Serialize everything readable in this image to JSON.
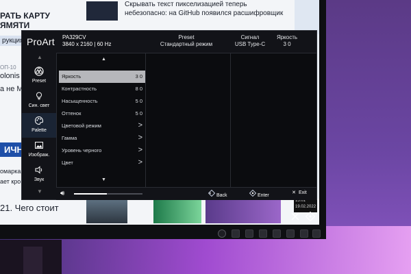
{
  "desktop": {
    "left_title": "РАТЬ КАРТУ\nЯМЯТИ",
    "left_sub": "рукция",
    "left_topic": "ОП-10",
    "left_topic2": "olonis",
    "left_topic3": "а не М",
    "left_tag": "ИЧНО",
    "left_small1": "омарка",
    "left_small2": "ает кро",
    "left_headline": "21. Чего стоит",
    "top_text": "Скрывать текст пикселизацией теперь небезопасно: на GitHub появился расшифровщик",
    "tray_date": "19.02.2022",
    "tray_time": "15:01"
  },
  "osd": {
    "brand": "ProArt",
    "model": "PA329CV",
    "resolution": "3840 x 2160",
    "refresh": "60 Hz",
    "header": {
      "preset_label": "Preset",
      "preset_value": "Стандартный режим",
      "signal_label": "Сигнал",
      "signal_value": "USB Type-C",
      "brightness_label": "Яркость",
      "brightness_value": "3 0"
    },
    "sidebar": [
      {
        "label": "Preset",
        "icon": "palette-wheel-icon"
      },
      {
        "label": "Син. свет",
        "icon": "bulb-icon"
      },
      {
        "label": "Palette",
        "icon": "palette-icon",
        "active": true
      },
      {
        "label": "Изображ.",
        "icon": "image-icon"
      },
      {
        "label": "Звук",
        "icon": "speaker-icon"
      }
    ],
    "menu": [
      {
        "label": "Яркость",
        "value": "3 0",
        "selected": true
      },
      {
        "label": "Контрастность",
        "value": "8 0"
      },
      {
        "label": "Насыщенность",
        "value": "5 0"
      },
      {
        "label": "Оттенок",
        "value": "5 0"
      },
      {
        "label": "Цветовой режим",
        "value": ">"
      },
      {
        "label": "Гамма",
        "value": ">"
      },
      {
        "label": "Уровень черного",
        "value": ">"
      },
      {
        "label": "Цвет",
        "value": ">"
      }
    ],
    "footer": {
      "volume_level": 0.48,
      "back": "Back",
      "enter": "Enter",
      "exit": "Exit"
    }
  }
}
